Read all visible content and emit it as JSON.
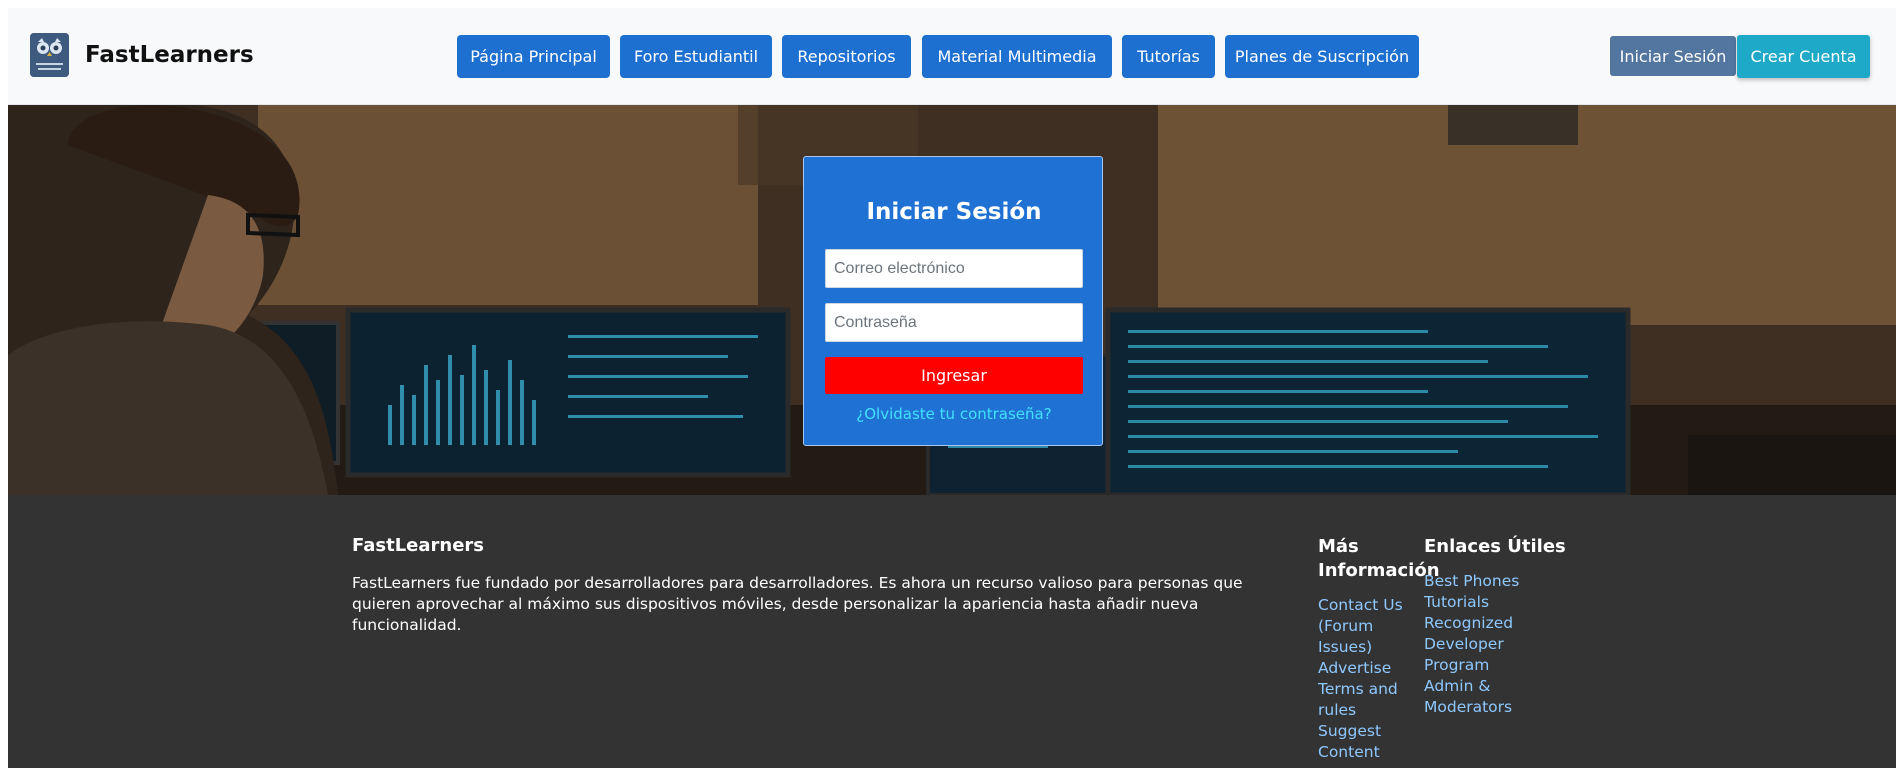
{
  "header": {
    "logo_icon": "owl-logo-icon",
    "brand": "FastLearners",
    "nav": [
      {
        "label": "Página Principal"
      },
      {
        "label": "Foro Estudiantil"
      },
      {
        "label": "Repositorios"
      },
      {
        "label": "Material Multimedia"
      },
      {
        "label": "Tutorías"
      },
      {
        "label": "Planes de Suscripción"
      }
    ],
    "login_label": "Iniciar Sesión",
    "signup_label": "Crear Cuenta"
  },
  "login_form": {
    "title": "Iniciar Sesión",
    "email_placeholder": "Correo electrónico",
    "password_placeholder": "Contraseña",
    "submit_label": "Ingresar",
    "forgot_link": "¿Olvidaste tu contraseña?"
  },
  "footer": {
    "about_title": "FastLearners",
    "about_text": "FastLearners fue fundado por desarrolladores para desarrolladores. Es ahora un recurso valioso para personas que quieren aprovechar al máximo sus dispositivos móviles, desde personalizar la apariencia hasta añadir nueva funcionalidad.",
    "more_info_title": "Más Información",
    "more_info_links": [
      "Contact Us (Forum Issues)",
      "Advertise",
      "Terms and rules",
      "Suggest Content"
    ],
    "useful_links_title": "Enlaces Útiles",
    "useful_links": [
      "Best Phones",
      "Tutorials",
      "Recognized Developer Program",
      "Admin & Moderators"
    ]
  },
  "colors": {
    "nav_button": "#1d6fd0",
    "login_button": "#5276a0",
    "signup_button": "#1ea9c8",
    "form_background": "#1f72d3",
    "submit_button": "#ff0000",
    "forgot_link": "#41e1ff",
    "footer_background": "#333333",
    "footer_link": "#8ec8ff"
  }
}
